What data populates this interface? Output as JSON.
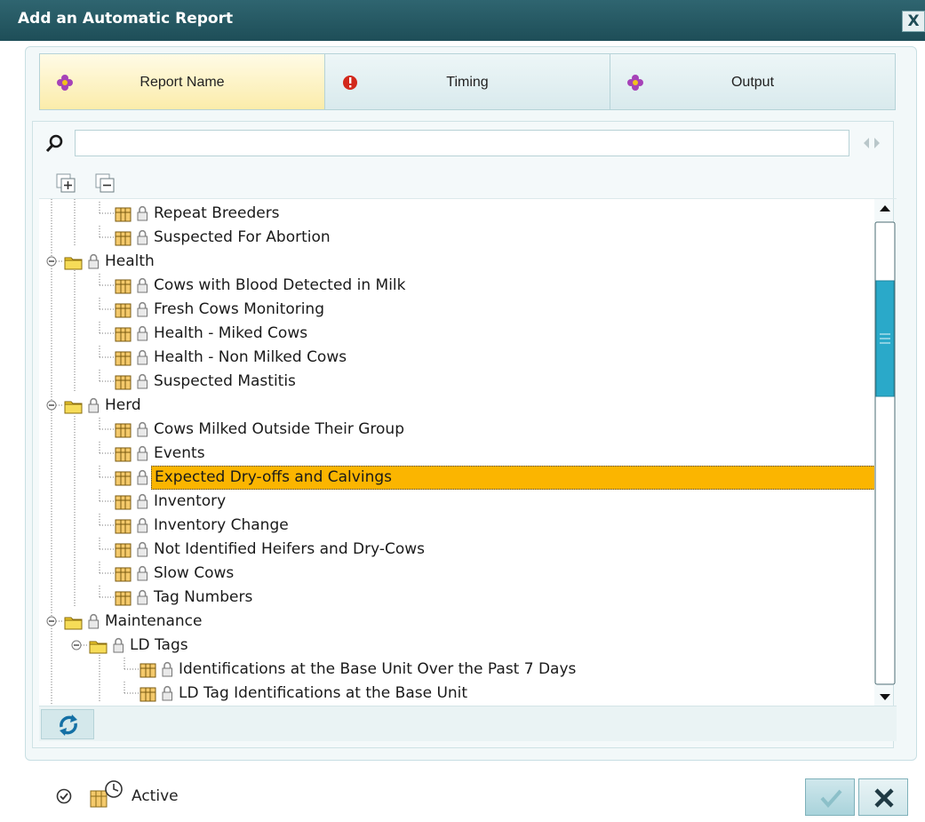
{
  "window": {
    "title": "Add an Automatic Report",
    "close_glyph": "X"
  },
  "tabs": [
    {
      "label": "Report Name",
      "icon": "flower-icon",
      "active": true
    },
    {
      "label": "Timing",
      "icon": "warning-icon",
      "active": false
    },
    {
      "label": "Output",
      "icon": "flower-icon",
      "active": false
    }
  ],
  "search": {
    "value": "",
    "placeholder": ""
  },
  "tree": {
    "items": [
      {
        "label": "Repeat Breeders",
        "type": "report",
        "level": 1
      },
      {
        "label": "Suspected For Abortion",
        "type": "report",
        "level": 1
      },
      {
        "label": "Health",
        "type": "folder",
        "level": 0
      },
      {
        "label": "Cows with Blood Detected in Milk",
        "type": "report",
        "level": 1
      },
      {
        "label": "Fresh Cows Monitoring",
        "type": "report",
        "level": 1
      },
      {
        "label": "Health - Miked Cows",
        "type": "report",
        "level": 1
      },
      {
        "label": "Health - Non Milked Cows",
        "type": "report",
        "level": 1
      },
      {
        "label": "Suspected Mastitis",
        "type": "report",
        "level": 1
      },
      {
        "label": "Herd",
        "type": "folder",
        "level": 0
      },
      {
        "label": "Cows Milked Outside Their Group",
        "type": "report",
        "level": 1
      },
      {
        "label": "Events",
        "type": "report",
        "level": 1
      },
      {
        "label": "Expected Dry-offs and Calvings",
        "type": "report",
        "level": 1,
        "selected": true
      },
      {
        "label": "Inventory",
        "type": "report",
        "level": 1
      },
      {
        "label": "Inventory Change",
        "type": "report",
        "level": 1
      },
      {
        "label": "Not Identified Heifers and Dry-Cows",
        "type": "report",
        "level": 1
      },
      {
        "label": "Slow Cows",
        "type": "report",
        "level": 1
      },
      {
        "label": "Tag Numbers",
        "type": "report",
        "level": 1
      },
      {
        "label": "Maintenance",
        "type": "folder",
        "level": 0
      },
      {
        "label": "LD Tags",
        "type": "folder",
        "level": 1
      },
      {
        "label": "Identifications at the Base Unit Over the Past 7 Days",
        "type": "report",
        "level": 2
      },
      {
        "label": "LD Tag Identifications at the Base Unit",
        "type": "report",
        "level": 2
      }
    ]
  },
  "footer": {
    "active_label": "Active"
  },
  "colors": {
    "title_bar": "#245a64",
    "selection": "#fbb500",
    "accent": "#2aa9c9"
  }
}
